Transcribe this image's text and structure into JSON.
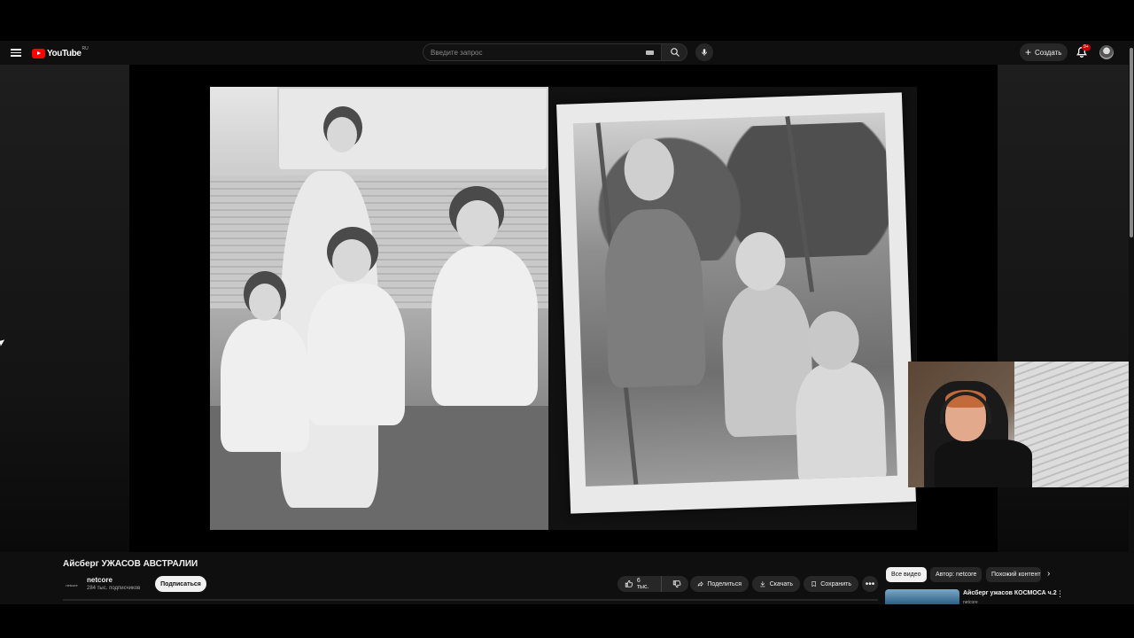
{
  "masthead": {
    "logo_text": "YouTube",
    "region": "RU",
    "search_placeholder": "Введите запрос",
    "create_label": "Создать",
    "notification_count": "9+"
  },
  "video": {
    "title": "Айсберг УЖАСОВ АВСТРАЛИИ",
    "channel": {
      "avatar_text": "netcore",
      "name": "netcore",
      "subscribers": "284 тыс. подписчиков",
      "subscribe_label": "Подписаться"
    },
    "actions": {
      "likes": "6 тыс.",
      "share": "Поделиться",
      "download": "Скачать",
      "save": "Сохранить",
      "more": "•••"
    }
  },
  "sidebar": {
    "chips": [
      {
        "label": "Все видео",
        "active": true
      },
      {
        "label": "Автор: netcore",
        "active": false
      },
      {
        "label": "Похожий контент",
        "active": false
      }
    ],
    "recommendation": {
      "title": "Айсберг ужасов КОСМОСА ч.2",
      "channel": "netcore"
    }
  },
  "colors": {
    "background": "#0f0f0f",
    "brand_red": "#ff0000",
    "chip_active": "#f1f1f1"
  }
}
